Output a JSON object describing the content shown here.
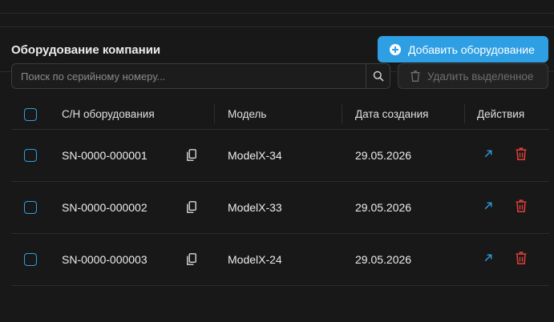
{
  "header": {
    "title": "Оборудование компании",
    "add_button": "Добавить оборудование"
  },
  "toolbar": {
    "search_placeholder": "Поиск по серийному номеру...",
    "delete_selected": "Удалить выделенное"
  },
  "table": {
    "columns": {
      "serial": "С/Н оборудования",
      "model": "Модель",
      "created": "Дата создания",
      "actions": "Действия"
    },
    "rows": [
      {
        "serial": "SN-0000-000001",
        "model": "ModelX-34",
        "created": "29.05.2026"
      },
      {
        "serial": "SN-0000-000002",
        "model": "ModelX-33",
        "created": "29.05.2026"
      },
      {
        "serial": "SN-0000-000003",
        "model": "ModelX-24",
        "created": "29.05.2026"
      }
    ]
  },
  "colors": {
    "accent": "#2f9fe3",
    "danger": "#e0413a",
    "background": "#181818"
  },
  "icons": [
    "plus-circle-icon",
    "search-icon",
    "trash-icon",
    "copy-icon",
    "open-external-icon"
  ]
}
